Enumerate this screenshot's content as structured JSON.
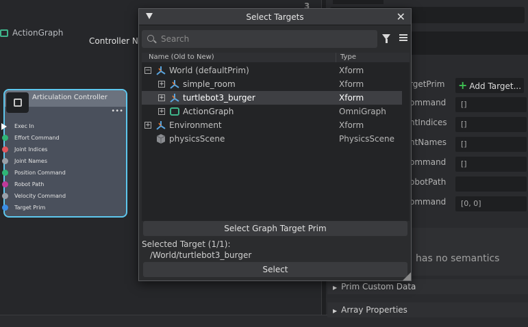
{
  "graph": {
    "title": "ActionGraph",
    "corner_number": "3",
    "node": {
      "title": "Articulation Controller",
      "menu": "•••",
      "ports": [
        {
          "label": "Exec In",
          "color": "#ffffff",
          "kind": "exec"
        },
        {
          "label": "Effort Command",
          "color": "#2fb676"
        },
        {
          "label": "Joint Indices",
          "color": "#e0565d"
        },
        {
          "label": "Joint Names",
          "color": "#9aa0a8"
        },
        {
          "label": "Position Command",
          "color": "#2fb676"
        },
        {
          "label": "Robot Path",
          "color": "#c03a9a"
        },
        {
          "label": "Velocity Command",
          "color": "#9aa0a8"
        },
        {
          "label": "Target Prim",
          "color": "#3a8ee6"
        }
      ]
    }
  },
  "properties": {
    "node_name": "Controller Node",
    "rows": [
      {
        "label": "rgetPrim",
        "value": ""
      },
      {
        "label": "ommand",
        "value": "[]"
      },
      {
        "label": "ntIndices",
        "value": "[]"
      },
      {
        "label": "ntNames",
        "value": "[]"
      },
      {
        "label": "ommand",
        "value": "[]"
      },
      {
        "label": "obotPath",
        "value": ""
      },
      {
        "label": "ommand",
        "value": "[0, 0]"
      }
    ],
    "add_target_label": "Add Target...",
    "semantics_text": "has no semantics",
    "sections": [
      "Prim Custom Data",
      "Array Properties"
    ]
  },
  "dialog": {
    "title": "Select Targets",
    "search_placeholder": "Search",
    "columns": {
      "name": "Name (Old to New)",
      "type": "Type"
    },
    "tree": [
      {
        "name": "World (defaultPrim)",
        "type": "Xform",
        "expander": "−",
        "icon": "xform-icon",
        "depth": 0,
        "selected": false
      },
      {
        "name": "simple_room",
        "type": "Xform",
        "expander": "+",
        "icon": "xform-icon",
        "depth": 1,
        "selected": false
      },
      {
        "name": "turtlebot3_burger",
        "type": "Xform",
        "expander": "+",
        "icon": "xform-icon",
        "depth": 1,
        "selected": true
      },
      {
        "name": "ActionGraph",
        "type": "OmniGraph",
        "expander": "+",
        "icon": "graph-icon",
        "depth": 1,
        "selected": false
      },
      {
        "name": "Environment",
        "type": "Xform",
        "expander": "+",
        "icon": "xform-icon",
        "depth": 0,
        "selected": false
      },
      {
        "name": "physicsScene",
        "type": "PhysicsScene",
        "expander": "",
        "icon": "cube-icon",
        "depth": 0,
        "selected": false
      }
    ],
    "graph_target_button": "Select Graph Target Prim",
    "selected_label": "Selected Target (1/1):",
    "selected_path": "/World/turtlebot3_burger",
    "select_button": "Select"
  }
}
